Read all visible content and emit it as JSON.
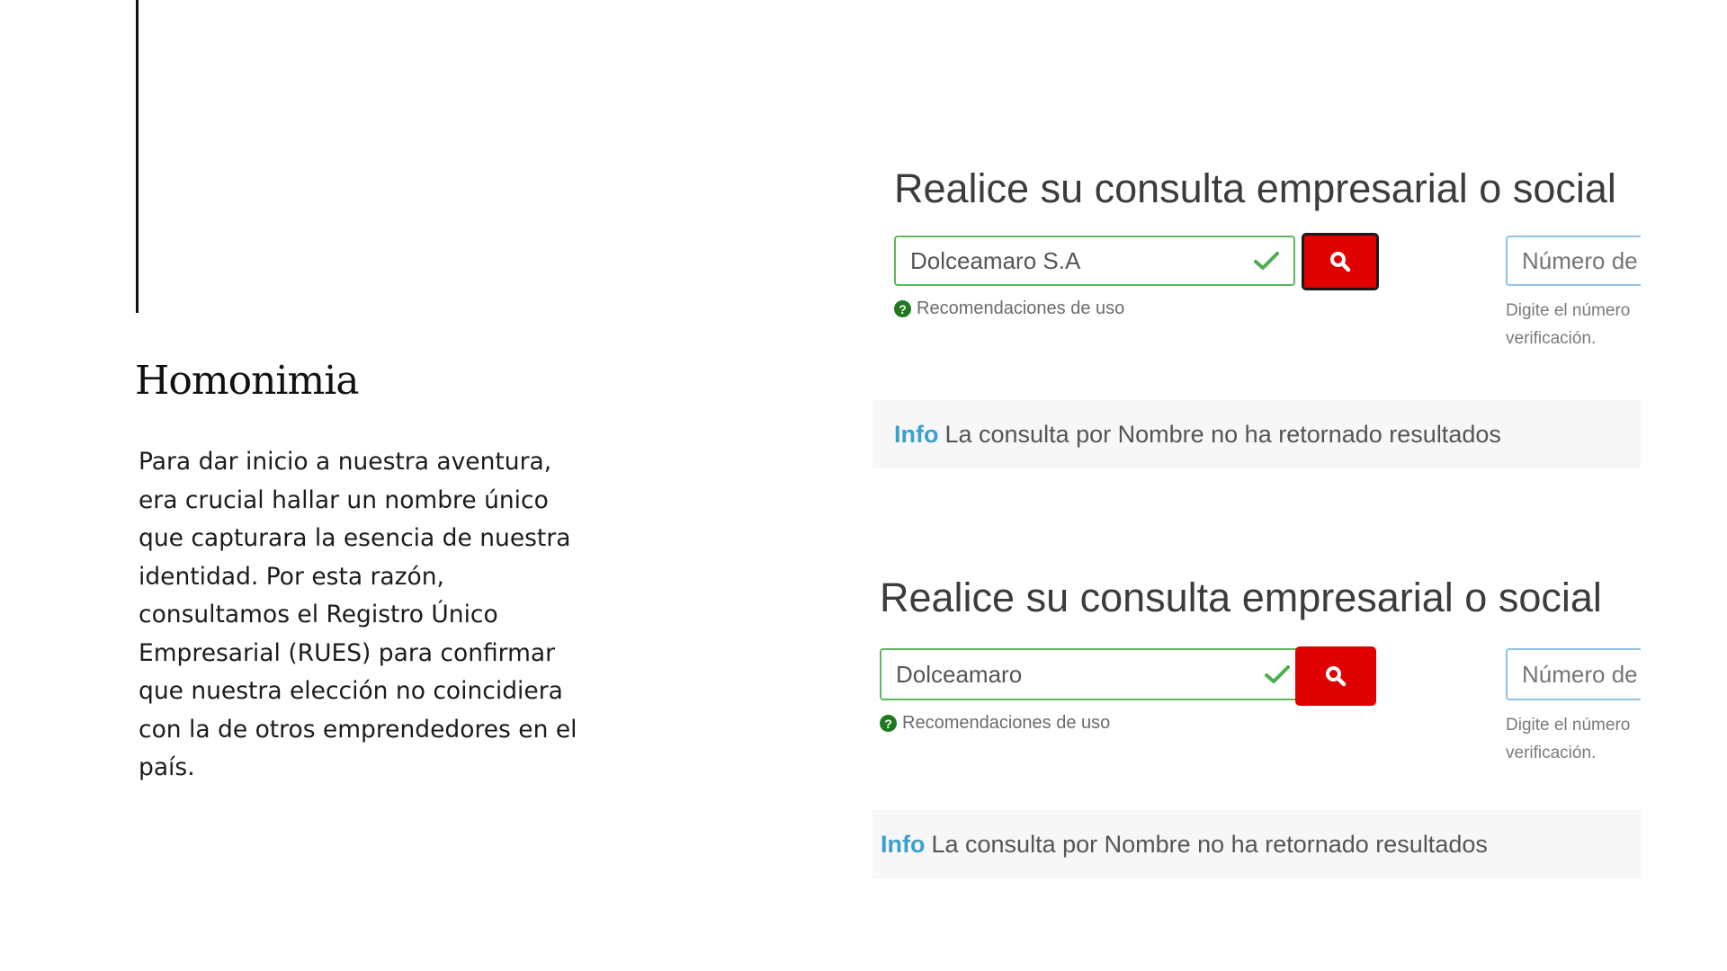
{
  "slide": {
    "heading": "Homonimia",
    "paragraph": "Para dar inicio a nuestra aventura, era crucial hallar un nombre único que capturara la esencia de nuestra identidad. Por esta razón, consultamos el Registro Único Empresarial (RUES) para confirmar que nuestra elección no coincidiera con la de otros emprendedores en el país."
  },
  "screenshots": [
    {
      "title": "Realice su consulta empresarial o social",
      "search_value": "Dolceamaro S.A",
      "help_text": "Recomendaciones de uso",
      "number_placeholder": "Número de",
      "number_help": "Digite el número verificación.",
      "info_label": "Info",
      "info_message": "La consulta por Nombre no ha retornado resultados"
    },
    {
      "title": "Realice su consulta empresarial o social",
      "search_value": "Dolceamaro",
      "help_text": "Recomendaciones de uso",
      "number_placeholder": "Número de",
      "number_help": "Digite el número verificación.",
      "info_label": "Info",
      "info_message": "La consulta por Nombre no ha retornado resultados"
    }
  ],
  "colors": {
    "search_button": "#e00000",
    "valid_border": "#5cb85c",
    "info_label": "#3aa0d0",
    "help_icon": "#1f7a1f"
  },
  "icons": {
    "search": "search-icon",
    "valid": "check-icon",
    "help": "question-circle-icon"
  }
}
